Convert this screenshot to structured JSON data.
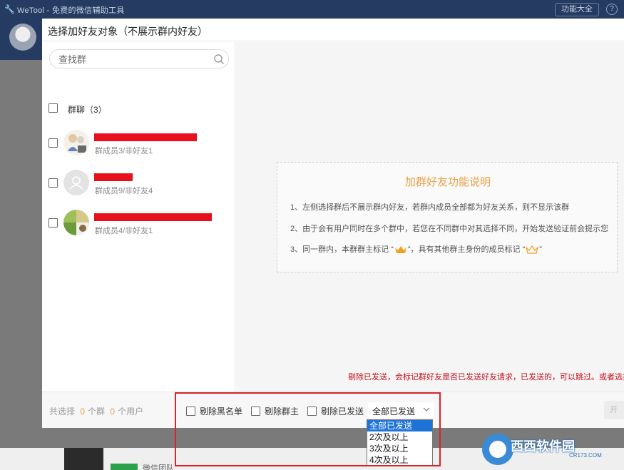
{
  "app": {
    "title": "WeTool - 免费的微信辅助工具",
    "func_button": "功能大全",
    "help": "?",
    "bottom_text": "微信团队"
  },
  "dialog": {
    "title": "选择加好友对象（不展示群内好友）",
    "search": {
      "placeholder": "查找群"
    },
    "group_header": "群聊（3）",
    "groups": [
      {
        "subtitle": "群成员3/非好友1"
      },
      {
        "subtitle": "群成员9/非好友4"
      },
      {
        "subtitle": "群成员4/非好友1"
      }
    ],
    "info": {
      "title": "加群好友功能说明",
      "line1": "1、左侧选择群后不展示群内好友，若群内成员全部都为好友关系，则不显示该群",
      "line2": "2、由于会有用户同时在多个群中，若您在不同群中对其选择不同，开始发送验证前会提示您",
      "line3a": "3、同一群内，本群群主标记 “",
      "line3b": "”，具有其他群主身份的成员标记 “",
      "line3c": "”"
    },
    "notice": "剔除已发送，会标记群好友是否已发送好友请求，已发送的，可以跳过。或者选择",
    "footer": {
      "total_label": "共选择",
      "groups_count": "0",
      "groups_unit": "个群",
      "users_count": "0",
      "users_unit": "个用户",
      "opt_blacklist": "剔除黑名单",
      "opt_owner": "剔除群主",
      "opt_sent": "剔除已发送",
      "select_value": "全部已发送",
      "start_label": "开始"
    },
    "dropdown_options": [
      "全部已发送",
      "2次及以上",
      "3次及以上",
      "4次及以上"
    ]
  },
  "watermark": {
    "text": "西西软件园",
    "site": "CR173.COM"
  },
  "colors": {
    "accent": "#e8a149",
    "notice_red": "#c0121f",
    "select_blue": "#1e73d8"
  }
}
